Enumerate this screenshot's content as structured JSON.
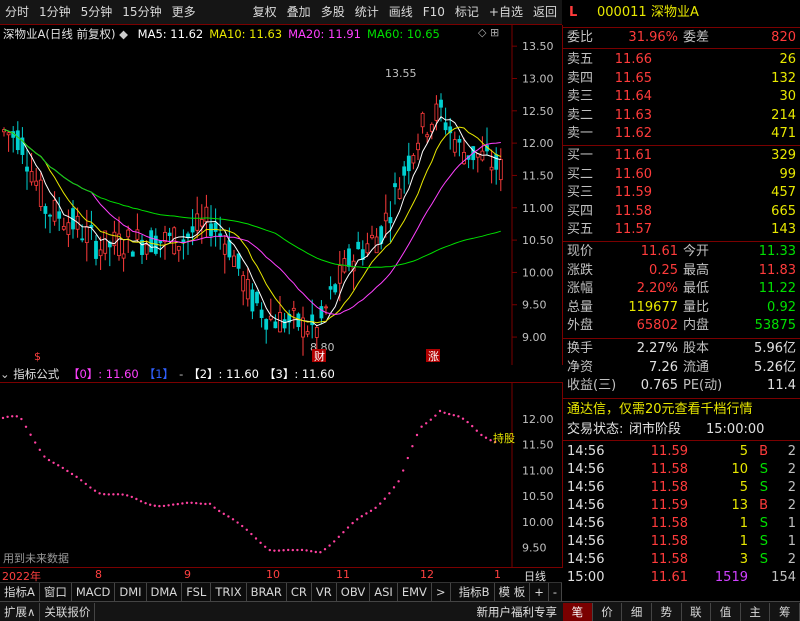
{
  "toolbar": {
    "left": [
      "分时",
      "1分钟",
      "5分钟",
      "15分钟",
      "更多"
    ],
    "right": [
      "复权",
      "叠加",
      "多股",
      "统计",
      "画线",
      "F10",
      "标记",
      "+自选",
      "返回"
    ]
  },
  "chart": {
    "stock_title": "深物业A(日线 前复权)",
    "ma": [
      {
        "label": "MA5: 11.62",
        "color": "#ffffff"
      },
      {
        "label": "MA10: 11.63",
        "color": "#e8e800"
      },
      {
        "label": "MA20: 11.91",
        "color": "#ff40ff"
      },
      {
        "label": "MA60: 10.65",
        "color": "#00e000"
      }
    ],
    "y_ticks": [
      "13.50",
      "13.00",
      "12.50",
      "12.00",
      "11.50",
      "11.00",
      "10.50",
      "10.00",
      "9.50",
      "9.00"
    ],
    "high_annotation": "13.55",
    "low_annotation": "8.80",
    "marker_dollar": "$",
    "marker_cai": "财",
    "marker_zhang": "涨",
    "colors": {
      "up": "#ff3b3b",
      "down": "#00d0d0",
      "ma5": "#ffffff",
      "ma10": "#e8e800",
      "ma20": "#ff40ff",
      "ma60": "#00e000",
      "axis": "#7a0000"
    }
  },
  "sub_chart": {
    "title": "指标公式",
    "params": [
      {
        "label": "【0】: 11.60",
        "color": "#ff40ff"
      },
      {
        "label": "【1】",
        "color": "#3060ff"
      },
      {
        "label": "-",
        "color": "#c0c0c0"
      },
      {
        "label": "【2】: 11.60",
        "color": "#ffffff"
      },
      {
        "label": "【3】: 11.60",
        "color": "#ffffff"
      }
    ],
    "y_ticks": [
      "12.00",
      "11.50",
      "11.00",
      "10.50",
      "10.00",
      "9.50"
    ],
    "label_right": "持股",
    "future_note": "用到未来数据"
  },
  "xaxis": {
    "labels": [
      "2022年",
      "8",
      "9",
      "10",
      "11",
      "12",
      "1"
    ],
    "period": "日线"
  },
  "tabs": {
    "left": [
      "指标A",
      "窗口",
      "MACD",
      "DMI",
      "DMA",
      "FSL",
      "TRIX",
      "BRAR",
      "CR",
      "VR",
      "OBV",
      "ASI",
      "EMV",
      ">"
    ],
    "right": [
      "指标B",
      "模 板",
      "+",
      "-"
    ]
  },
  "bottom_bar": {
    "left": [
      "扩展∧",
      "关联报价"
    ],
    "promo": "新用户福利专享",
    "tabs": [
      "笔",
      "价",
      "细",
      "势",
      "联",
      "值",
      "主",
      "筹"
    ]
  },
  "quote": {
    "code": "000011",
    "name": "深物业A",
    "weibi_label": "委比",
    "weibi": "31.96%",
    "weicha_label": "委差",
    "weicha": "820",
    "asks": [
      {
        "label": "卖五",
        "price": "11.66",
        "vol": "26"
      },
      {
        "label": "卖四",
        "price": "11.65",
        "vol": "132"
      },
      {
        "label": "卖三",
        "price": "11.64",
        "vol": "30"
      },
      {
        "label": "卖二",
        "price": "11.63",
        "vol": "214"
      },
      {
        "label": "卖一",
        "price": "11.62",
        "vol": "471"
      }
    ],
    "bids": [
      {
        "label": "买一",
        "price": "11.61",
        "vol": "329"
      },
      {
        "label": "买二",
        "price": "11.60",
        "vol": "99"
      },
      {
        "label": "买三",
        "price": "11.59",
        "vol": "457"
      },
      {
        "label": "买四",
        "price": "11.58",
        "vol": "665"
      },
      {
        "label": "买五",
        "price": "11.57",
        "vol": "143"
      }
    ],
    "stats": [
      {
        "l1": "现价",
        "v1": "11.61",
        "c1": "red",
        "l2": "今开",
        "v2": "11.33",
        "c2": "green"
      },
      {
        "l1": "涨跌",
        "v1": "0.25",
        "c1": "red",
        "l2": "最高",
        "v2": "11.83",
        "c2": "red"
      },
      {
        "l1": "涨幅",
        "v1": "2.20%",
        "c1": "red",
        "l2": "最低",
        "v2": "11.22",
        "c2": "green"
      },
      {
        "l1": "总量",
        "v1": "119677",
        "c1": "yellow",
        "l2": "量比",
        "v2": "0.92",
        "c2": "green"
      },
      {
        "l1": "外盘",
        "v1": "65802",
        "c1": "red",
        "l2": "内盘",
        "v2": "53875",
        "c2": "green"
      }
    ],
    "fin": [
      {
        "l1": "换手",
        "v1": "2.27%",
        "l2": "股本",
        "v2": "5.96亿"
      },
      {
        "l1": "净资",
        "v1": "7.26",
        "l2": "流通",
        "v2": "5.26亿"
      },
      {
        "l1": "收益(三)",
        "v1": "0.765",
        "l2": "PE(动)",
        "v2": "11.4"
      }
    ],
    "promo": "通达信，仅需20元查看千档行情",
    "trade_status_label": "交易状态:",
    "trade_status": "闭市阶段",
    "trade_time": "15:00:00",
    "ticks": [
      {
        "t": "14:56",
        "p": "11.59",
        "v": "5",
        "d": "B",
        "n": "2"
      },
      {
        "t": "14:56",
        "p": "11.58",
        "v": "10",
        "d": "S",
        "n": "2"
      },
      {
        "t": "14:56",
        "p": "11.58",
        "v": "5",
        "d": "S",
        "n": "2"
      },
      {
        "t": "14:56",
        "p": "11.59",
        "v": "13",
        "d": "B",
        "n": "2"
      },
      {
        "t": "14:56",
        "p": "11.58",
        "v": "1",
        "d": "S",
        "n": "1"
      },
      {
        "t": "14:56",
        "p": "11.58",
        "v": "1",
        "d": "S",
        "n": "1"
      },
      {
        "t": "14:56",
        "p": "11.58",
        "v": "3",
        "d": "S",
        "n": "2"
      },
      {
        "t": "15:00",
        "p": "11.61",
        "v": "1519",
        "d": "",
        "n": "154"
      }
    ]
  }
}
